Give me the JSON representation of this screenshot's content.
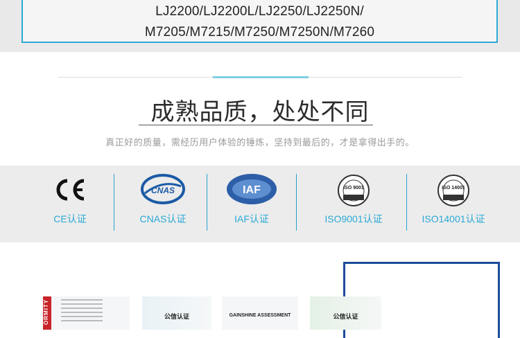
{
  "models": {
    "line1": "LJ2200/LJ2200L/LJ2250/LJ2250N/",
    "line2": "M7205/M7215/M7250/M7250N/M7260"
  },
  "headline": "成熟品质，处处不同",
  "subtitle": "真正好的质量，需经历用户体验的锤炼，坚持到最后的，才是拿得出手的。",
  "certifications": [
    {
      "label": "CE认证",
      "icon": "ce-mark-icon"
    },
    {
      "label": "CNAS认证",
      "icon": "cnas-logo-icon"
    },
    {
      "label": "IAF认证",
      "icon": "iaf-logo-icon"
    },
    {
      "label": "ISO9001认证",
      "icon": "iso9001-seal-icon"
    },
    {
      "label": "ISO14001认证",
      "icon": "iso14001-seal-icon"
    }
  ],
  "logo_text": {
    "ce": "CE",
    "cnas": "CNAS",
    "iaf": "IAF",
    "iso9001": "ISO 9001",
    "iso14001": "ISO 14001"
  },
  "documents": {
    "doc1_side": "ORMITY",
    "doc2_title": "公信认证",
    "doc3_title": "GAINSHINE ASSESSMENT",
    "doc4_title": "公信认证"
  },
  "colors": {
    "accent": "#2aa9d6",
    "frame": "#1e4b9a"
  }
}
